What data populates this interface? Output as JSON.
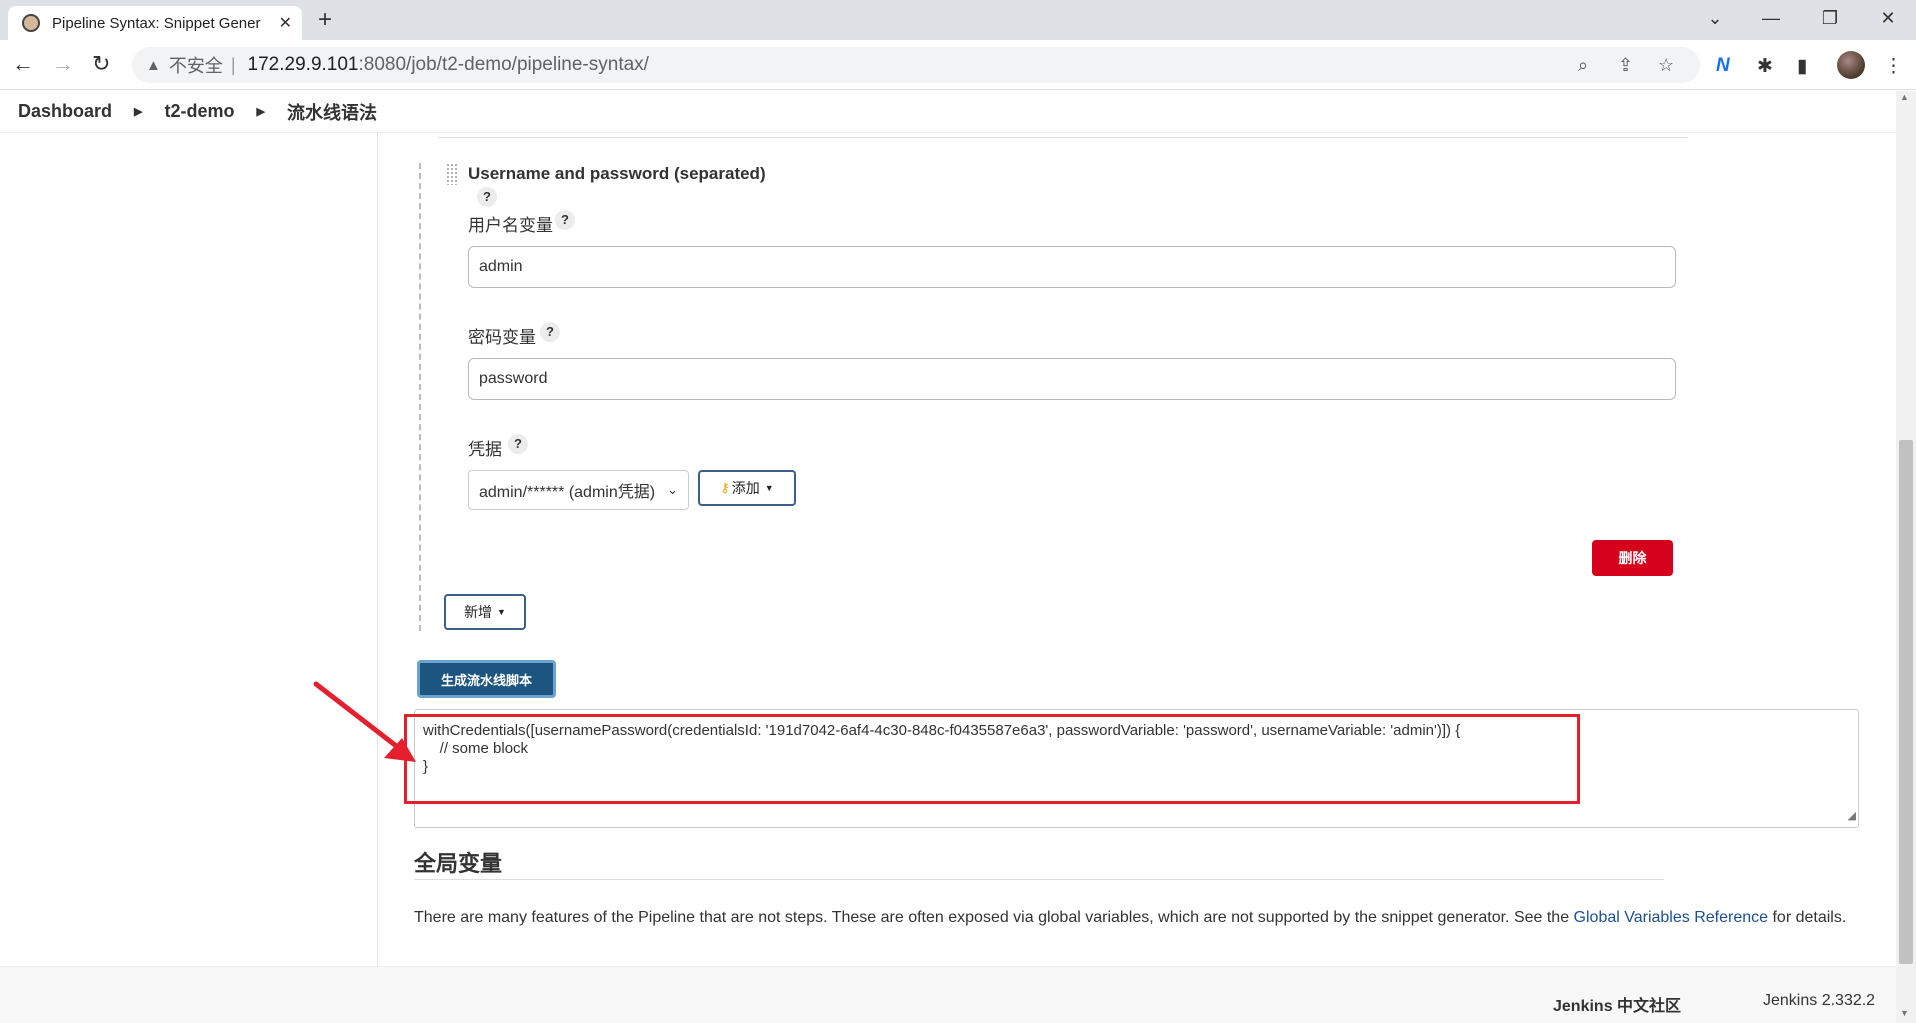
{
  "browser": {
    "tab_title": "Pipeline Syntax: Snippet Gener",
    "tab_close": "✕",
    "new_tab": "+",
    "insecure_label": "不安全",
    "url_host": "172.29.9.101",
    "url_rest": ":8080/job/t2-demo/pipeline-syntax/"
  },
  "breadcrumb": {
    "items": [
      "Dashboard",
      "t2-demo",
      "流水线语法"
    ]
  },
  "form": {
    "binding_title": "Username and password (separated)",
    "help_mark": "?",
    "username_label": "用户名变量",
    "username_value": "admin",
    "password_label": "密码变量",
    "password_value": "password",
    "credentials_label": "凭据",
    "credentials_selected": "admin/****** (admin凭据)",
    "add_button": "添加",
    "delete_button": "删除",
    "new_button": "新增",
    "generate_button": "生成流水线脚本"
  },
  "snippet": {
    "lines": [
      "withCredentials([usernamePassword(credentialsId: '191d7042-6af4-4c30-848c-f0435587e6a3', passwordVariable: 'password', usernameVariable: 'admin')]) {",
      "    // some block",
      "}"
    ]
  },
  "global_vars": {
    "title": "全局变量",
    "desc_before": "There are many features of the Pipeline that are not steps. These are often exposed via global variables, which are not supported by the snippet generator. See the ",
    "link": "Global Variables Reference",
    "desc_after": " for details."
  },
  "footer": {
    "community": "Jenkins 中文社区",
    "version": "Jenkins 2.332.2"
  },
  "colors": {
    "delete": "#d5001b",
    "generate": "#1b5580",
    "highlight": "#e5202e",
    "link": "#1d4f91"
  }
}
